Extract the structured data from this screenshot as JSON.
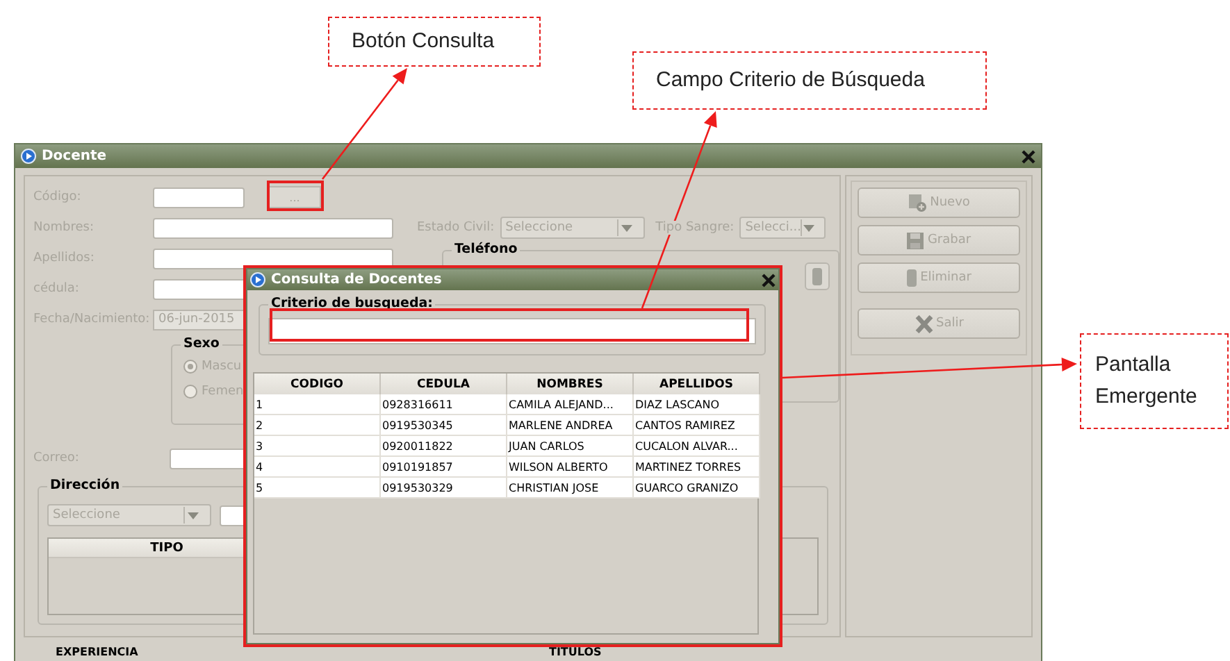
{
  "annotations": [
    {
      "text": "Botón Consulta"
    },
    {
      "text": "Campo Criterio de Búsqueda"
    },
    {
      "text": "Pantalla Emergente"
    }
  ],
  "window": {
    "title": "Docente"
  },
  "form": {
    "codigo_label": "Código:",
    "lookup_button": "...",
    "nombres_label": "Nombres:",
    "apellidos_label": "Apellidos:",
    "cedula_label": "cédula:",
    "fecha_label": "Fecha/Nacimiento:",
    "fecha_value": "06-jun-2015",
    "estado_civil": {
      "label": "Estado Civil:",
      "value": "Seleccione"
    },
    "tipo_sangre": {
      "label": "Tipo Sangre:",
      "value": "Selecci..."
    },
    "sexo": {
      "title": "Sexo",
      "options": [
        {
          "label": "Mascu",
          "selected": true
        },
        {
          "label": "Femen",
          "selected": false
        }
      ]
    },
    "telefono": {
      "title": "Teléfono"
    },
    "correo_label": "Correo:",
    "direccion": {
      "title": "Dirección",
      "type_value": "Seleccione",
      "column": "TIPO"
    },
    "bottom_tables": [
      "EXPERIENCIA",
      "TITULOS"
    ]
  },
  "actions": [
    {
      "label": "Nuevo",
      "kind": "new"
    },
    {
      "label": "Grabar",
      "kind": "save"
    },
    {
      "label": "Eliminar",
      "kind": "delete"
    },
    {
      "label": "Salir",
      "kind": "exit"
    }
  ],
  "dialog": {
    "title": "Consulta de Docentes",
    "search_label": "Criterio de busqueda:",
    "columns": [
      "CODIGO",
      "CEDULA",
      "NOMBRES",
      "APELLIDOS"
    ],
    "rows": [
      [
        "1",
        "0928316611",
        "CAMILA ALEJAND...",
        "DIAZ LASCANO"
      ],
      [
        "2",
        "0919530345",
        "MARLENE ANDREA",
        "CANTOS RAMIREZ"
      ],
      [
        "3",
        "0920011822",
        "JUAN CARLOS",
        "CUCALON ALVAR..."
      ],
      [
        "4",
        "0910191857",
        "WILSON ALBERTO",
        "MARTINEZ TORRES"
      ],
      [
        "5",
        "0919530329",
        "CHRISTIAN JOSE",
        "GUARCO GRANIZO"
      ]
    ]
  }
}
